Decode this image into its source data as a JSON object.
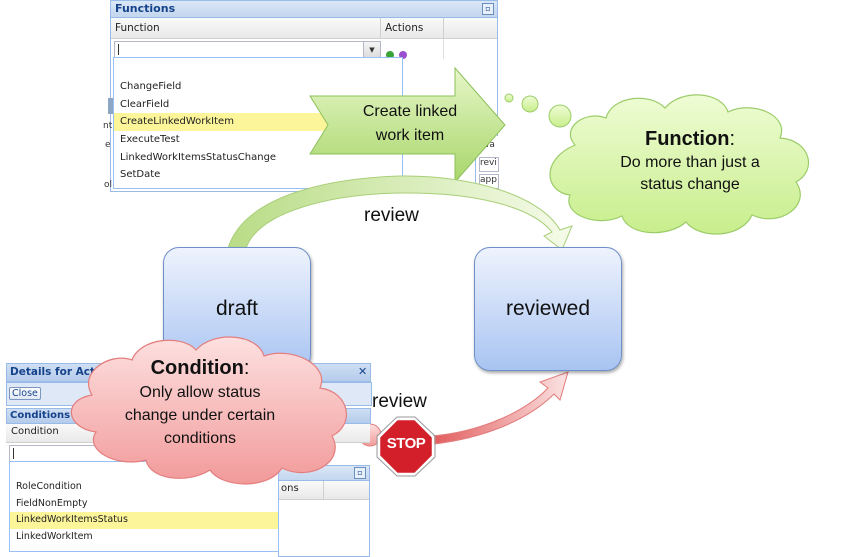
{
  "functions_panel": {
    "title": "Functions",
    "col_function": "Function",
    "col_actions": "Actions",
    "options": [
      "ChangeField",
      "ClearField",
      "CreateLinkedWorkItem",
      "ExecuteTest",
      "LinkedWorkItemsStatusChange",
      "SetDate"
    ],
    "selected_option": "CreateLinkedWorkItem",
    "side_fragments": [
      "nt",
      "e",
      "ol"
    ],
    "right_fragments": [
      "wa",
      "revi",
      "app"
    ]
  },
  "arrow_callout": {
    "line1": "Create linked",
    "line2": "work item"
  },
  "function_cloud": {
    "title": "Function",
    "colon": ":",
    "line1": "Do more than just a",
    "line2": "status change"
  },
  "states": {
    "draft": "draft",
    "reviewed": "reviewed"
  },
  "transitions": {
    "top_label": "review",
    "bottom_label": "review"
  },
  "condition_cloud": {
    "title": "Condition",
    "colon": ":",
    "line1": "Only allow status",
    "line2": "change under certain",
    "line3": "conditions"
  },
  "details_panel": {
    "title": "Details for Actio",
    "close_label": "Close",
    "section_title": "Conditions",
    "col_condition": "Condition",
    "col_actions_fragment": "ons",
    "options": [
      "RoleCondition",
      "FieldNonEmpty",
      "LinkedWorkItemsStatus",
      "LinkedWorkItem"
    ],
    "selected_option": "LinkedWorkItemsStatus"
  },
  "stop_sign": {
    "text": "STOP",
    "color": "#d21f2a"
  },
  "colors": {
    "arrow_green": "#a8d66a",
    "cloud_green": "#d9f5a6",
    "cloud_pink": "#f8b8b8",
    "state_blue": "#a9c4f2",
    "highlight": "#fcf59a"
  }
}
